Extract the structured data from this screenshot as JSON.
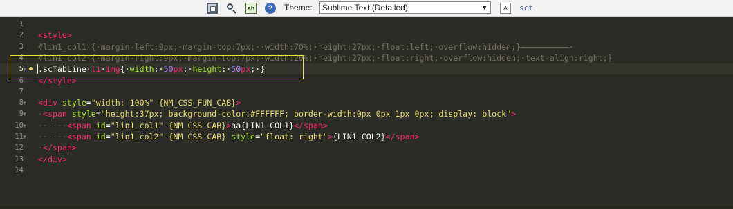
{
  "toolbar": {
    "theme_label": "Theme:",
    "theme_value": "Sublime Text (Detailed)",
    "replace_glyph": "ab",
    "help_glyph": "?",
    "font_glyph": "A",
    "sct": "sct",
    "dropdown_glyph": "▼"
  },
  "icons": [
    "fullscreen-icon",
    "search-icon",
    "replace-icon",
    "help-icon",
    "font-size-icon"
  ],
  "editor": {
    "active_line": 5,
    "line_numbers": [
      "1",
      "2",
      "3",
      "4",
      "5",
      "6",
      "7",
      "8",
      "9",
      "10",
      "11",
      "12",
      "13",
      "14"
    ],
    "fold_markers": {
      "5": "▼",
      "8": "▼",
      "9": "▼",
      "10": "▼",
      "11": "▼"
    },
    "colors": {
      "background": "#2b2c25",
      "tag": "#f92672",
      "attr": "#a6e22e",
      "string": "#e6db74",
      "number": "#ae81ff",
      "comment": "#75715e",
      "text": "#f8f8f2"
    },
    "lines": [
      [],
      [
        [
          "t",
          "<style>"
        ]
      ],
      [
        [
          "c",
          "#lin1_col1·{·margin-left:9px;·margin-top:7px;··width:70%;·height:27px;·float:left;·overflow:hidden;}——————————·"
        ]
      ],
      [
        [
          "c",
          "#lin1_col2·{·margin-right:9px;·margin-top:7px;·width:20%;·height:27px;·float:right;·overflow:hidden;·text-align:right;}"
        ]
      ],
      [
        [
          "w",
          ".scTabLine·"
        ],
        [
          "t",
          "li"
        ],
        [
          "w",
          "·"
        ],
        [
          "t",
          "img"
        ],
        [
          "w",
          "{·"
        ],
        [
          "a",
          "width"
        ],
        [
          "w",
          ":·"
        ],
        [
          "n",
          "50"
        ],
        [
          "t",
          "px"
        ],
        [
          "w",
          ";·"
        ],
        [
          "a",
          "height"
        ],
        [
          "w",
          ":·"
        ],
        [
          "n",
          "50"
        ],
        [
          "t",
          "px"
        ],
        [
          "w",
          ";·}"
        ]
      ],
      [
        [
          "t",
          "</style>"
        ]
      ],
      [],
      [
        [
          "t",
          "<div"
        ],
        [
          "w",
          " "
        ],
        [
          "a",
          "style"
        ],
        [
          "w",
          "="
        ],
        [
          "s",
          "\"width: 100%\""
        ],
        [
          "w",
          " "
        ],
        [
          "s",
          "{NM_CSS_FUN_CAB}"
        ],
        [
          "t",
          ">"
        ]
      ],
      [
        [
          "ws",
          "·"
        ],
        [
          "t",
          "<span"
        ],
        [
          "w",
          " "
        ],
        [
          "a",
          "style"
        ],
        [
          "w",
          "="
        ],
        [
          "s",
          "\"height:37px; background-color:#FFFFFF; border-width:0px 0px 1px 0px; display: block\""
        ],
        [
          "t",
          ">"
        ]
      ],
      [
        [
          "ws",
          "······"
        ],
        [
          "t",
          "<span"
        ],
        [
          "w",
          " "
        ],
        [
          "a",
          "id"
        ],
        [
          "w",
          "="
        ],
        [
          "s",
          "\"lin1_col1\""
        ],
        [
          "w",
          " "
        ],
        [
          "s",
          "{NM_CSS_CAB}"
        ],
        [
          "t",
          ">"
        ],
        [
          "w",
          "aa{LIN1_COL1}"
        ],
        [
          "t",
          "</span>"
        ]
      ],
      [
        [
          "ws",
          "······"
        ],
        [
          "t",
          "<span"
        ],
        [
          "w",
          " "
        ],
        [
          "a",
          "id"
        ],
        [
          "w",
          "="
        ],
        [
          "s",
          "\"lin1_col2\""
        ],
        [
          "w",
          " "
        ],
        [
          "s",
          "{NM_CSS_CAB}"
        ],
        [
          "w",
          " "
        ],
        [
          "a",
          "style"
        ],
        [
          "w",
          "="
        ],
        [
          "s",
          "\"float: right\""
        ],
        [
          "t",
          ">"
        ],
        [
          "w",
          "{LIN1_COL2}"
        ],
        [
          "t",
          "</span>"
        ]
      ],
      [
        [
          "ws",
          "·"
        ],
        [
          "t",
          "</span>"
        ]
      ],
      [
        [
          "t",
          "</div>"
        ]
      ],
      []
    ]
  }
}
